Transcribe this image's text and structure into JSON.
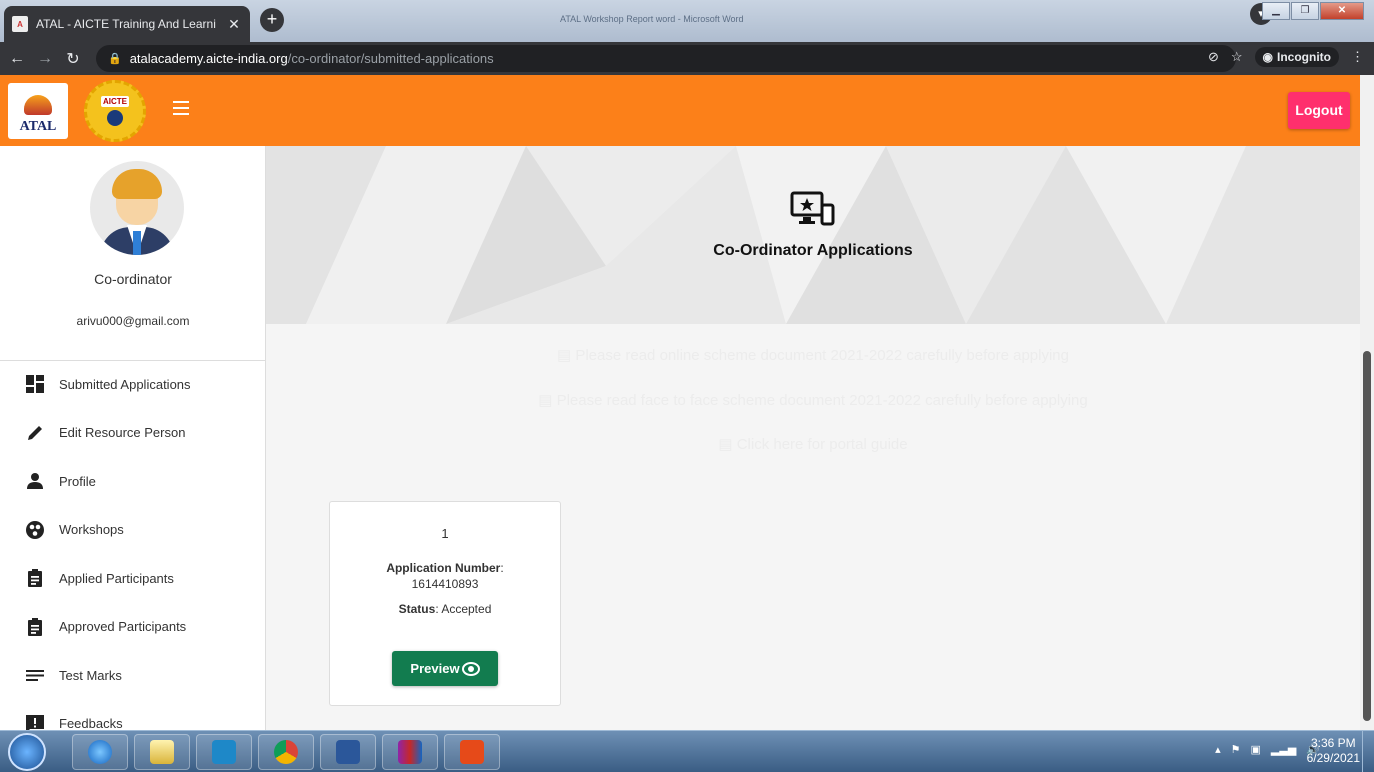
{
  "browser": {
    "tab_title": "ATAL - AICTE Training And Learni",
    "window_title": "ATAL Workshop Report word - Microsoft Word",
    "url_host": "atalacademy.aicte-india.org",
    "url_path": "/co-ordinator/submitted-applications",
    "incognito_label": "Incognito"
  },
  "header": {
    "atal_logo_text": "ATAL",
    "aicte_logo_text": "AICTE",
    "logout_label": "Logout",
    "color": "#fc8019"
  },
  "sidebar": {
    "role": "Co-ordinator",
    "email": "arivu000@gmail.com",
    "items": [
      {
        "label": "Submitted Applications",
        "icon": "dashboard-icon"
      },
      {
        "label": "Edit Resource Person",
        "icon": "pencil-icon"
      },
      {
        "label": "Profile",
        "icon": "person-icon"
      },
      {
        "label": "Workshops",
        "icon": "workshop-icon"
      },
      {
        "label": "Applied Participants",
        "icon": "clipboard-icon"
      },
      {
        "label": "Approved Participants",
        "icon": "clipboard-icon"
      },
      {
        "label": "Test Marks",
        "icon": "list-icon"
      },
      {
        "label": "Feedbacks",
        "icon": "feedback-icon"
      }
    ]
  },
  "main": {
    "title": "Co-Ordinator Applications",
    "notices": [
      "Please read online scheme document 2021-2022 carefully before applying",
      "Please read face to face scheme document 2021-2022 carefully before applying",
      "Click here for portal guide"
    ],
    "card": {
      "index": "1",
      "app_number_label": "Application Number",
      "app_number": "1614410893",
      "status_label": "Status",
      "status": "Accepted",
      "preview_label": "Preview"
    }
  },
  "taskbar": {
    "time": "3:36 PM",
    "date": "6/29/2021"
  }
}
